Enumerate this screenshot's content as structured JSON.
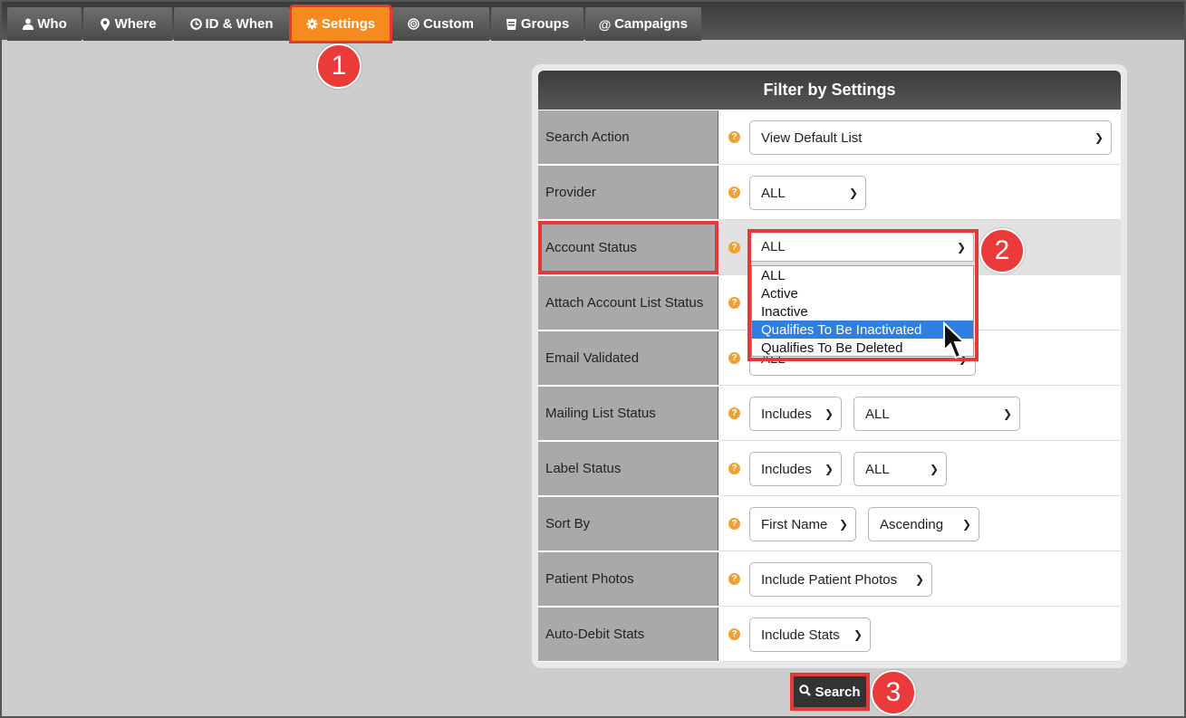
{
  "tabs": [
    {
      "label": "Who",
      "icon": "user-icon"
    },
    {
      "label": "Where",
      "icon": "map-pin-icon"
    },
    {
      "label": "ID & When",
      "icon": "clock-icon"
    },
    {
      "label": "Settings",
      "icon": "gear-icon",
      "active": true
    },
    {
      "label": "Custom",
      "icon": "target-icon"
    },
    {
      "label": "Groups",
      "icon": "groups-icon"
    },
    {
      "label": "Campaigns",
      "icon": "at-icon"
    }
  ],
  "callouts": [
    "1",
    "2",
    "3"
  ],
  "panel": {
    "title": "Filter by Settings",
    "help_icon": "?",
    "rows": [
      {
        "label": "Search Action",
        "selects": [
          "View Default List"
        ]
      },
      {
        "label": "Provider",
        "selects": [
          "ALL"
        ]
      },
      {
        "label": "Account Status",
        "selects": [
          "ALL"
        ]
      },
      {
        "label": "Attach Account List Status",
        "selects": []
      },
      {
        "label": "Email Validated",
        "selects": [
          "ALL"
        ]
      },
      {
        "label": "Mailing List Status",
        "selects": [
          "Includes",
          "ALL"
        ]
      },
      {
        "label": "Label Status",
        "selects": [
          "Includes",
          "ALL"
        ]
      },
      {
        "label": "Sort By",
        "selects": [
          "First Name",
          "Ascending"
        ]
      },
      {
        "label": "Patient Photos",
        "selects": [
          "Include Patient Photos"
        ]
      },
      {
        "label": "Auto-Debit Stats",
        "selects": [
          "Include Stats"
        ]
      }
    ]
  },
  "account_status_dropdown": {
    "options": [
      "ALL",
      "Active",
      "Inactive",
      "Qualifies To Be Inactivated",
      "Qualifies To Be Deleted"
    ],
    "highlighted": "Qualifies To Be Inactivated"
  },
  "search_button": {
    "label": "Search",
    "icon": "search-icon"
  },
  "colors": {
    "accent": "#f58a1f",
    "annotation": "#e53935",
    "highlight": "#2f7fe0"
  }
}
